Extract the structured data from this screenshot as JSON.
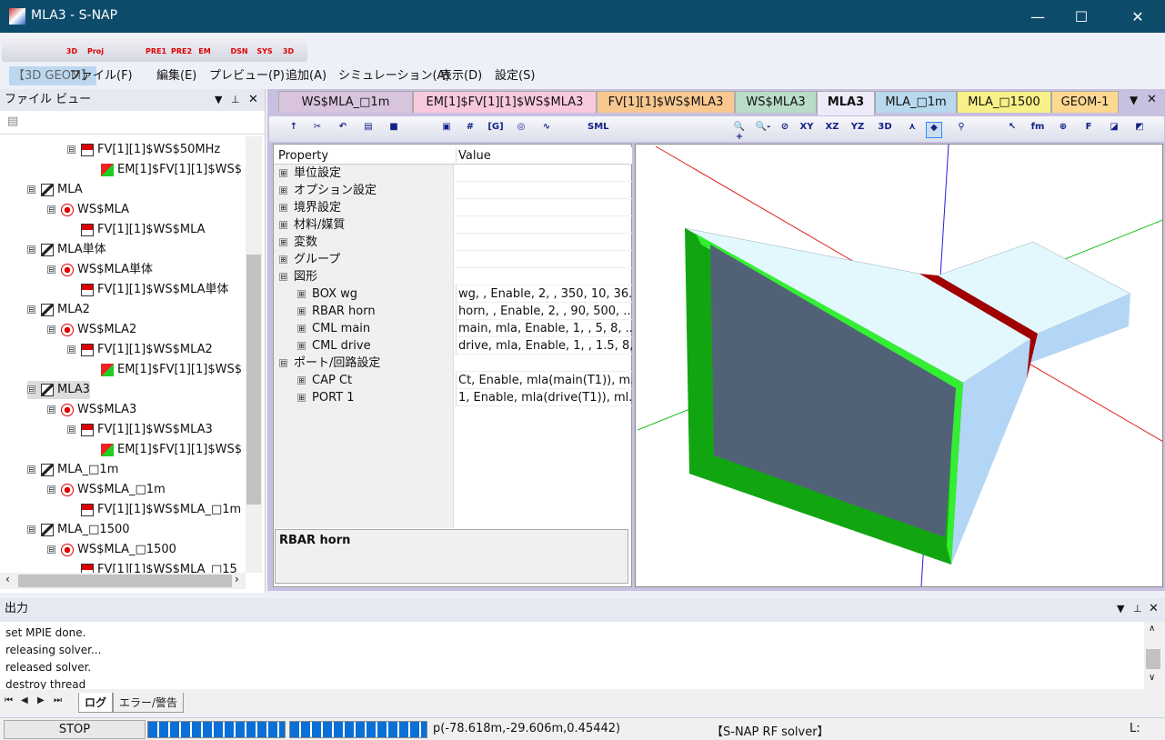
{
  "window": {
    "title": "MLA3 - S-NAP",
    "minimize": "—",
    "maximize": "☐",
    "close": "✕"
  },
  "toolbar": {
    "buttons": [
      {
        "name": "open-icon",
        "label": ""
      },
      {
        "name": "layout-icon",
        "label": ""
      },
      {
        "name": "3d-icon",
        "label": "3D"
      },
      {
        "name": "proj-icon",
        "label": "Proj"
      },
      {
        "name": "save-icon",
        "label": ""
      },
      {
        "name": "pre1-icon",
        "label": "PRE1"
      },
      {
        "name": "pre2-icon",
        "label": "PRE2"
      },
      {
        "name": "em-icon",
        "label": "EM"
      },
      {
        "name": "dsn-icon",
        "label": "DSN"
      },
      {
        "name": "sys-icon",
        "label": "SYS"
      },
      {
        "name": "3d-help-icon",
        "label": "3D"
      }
    ]
  },
  "menu": {
    "items": [
      "【3D GEOM】",
      "ファイル(F)",
      "編集(E)",
      "プレビュー(P)",
      "追加(A)",
      "シミュレーション(A)",
      "表示(D)",
      "設定(S)"
    ]
  },
  "fileview": {
    "title": "ファイル ビュー",
    "items": [
      {
        "level": 2,
        "icon": "fv",
        "exp": "⊟",
        "text": "FV[1][1]$WS$50MHz"
      },
      {
        "level": 3,
        "icon": "em",
        "exp": "",
        "text": "EM[1]$FV[1][1]$WS$"
      },
      {
        "level": 0,
        "icon": "geom",
        "exp": "⊟",
        "text": "MLA"
      },
      {
        "level": 1,
        "icon": "ws",
        "exp": "⊟",
        "text": "WS$MLA"
      },
      {
        "level": 2,
        "icon": "fv",
        "exp": "",
        "text": "FV[1][1]$WS$MLA"
      },
      {
        "level": 0,
        "icon": "geom",
        "exp": "⊟",
        "text": "MLA単体"
      },
      {
        "level": 1,
        "icon": "ws",
        "exp": "⊟",
        "text": "WS$MLA単体"
      },
      {
        "level": 2,
        "icon": "fv",
        "exp": "",
        "text": "FV[1][1]$WS$MLA単体"
      },
      {
        "level": 0,
        "icon": "geom",
        "exp": "⊟",
        "text": "MLA2"
      },
      {
        "level": 1,
        "icon": "ws",
        "exp": "⊟",
        "text": "WS$MLA2"
      },
      {
        "level": 2,
        "icon": "fv",
        "exp": "⊟",
        "text": "FV[1][1]$WS$MLA2"
      },
      {
        "level": 3,
        "icon": "em",
        "exp": "",
        "text": "EM[1]$FV[1][1]$WS$"
      },
      {
        "level": 0,
        "icon": "geom",
        "exp": "⊟",
        "text": "MLA3",
        "selected": true
      },
      {
        "level": 1,
        "icon": "ws",
        "exp": "⊟",
        "text": "WS$MLA3"
      },
      {
        "level": 2,
        "icon": "fv",
        "exp": "⊟",
        "text": "FV[1][1]$WS$MLA3"
      },
      {
        "level": 3,
        "icon": "em",
        "exp": "",
        "text": "EM[1]$FV[1][1]$WS$"
      },
      {
        "level": 0,
        "icon": "geom",
        "exp": "⊟",
        "text": "MLA_□1m"
      },
      {
        "level": 1,
        "icon": "ws",
        "exp": "⊟",
        "text": "WS$MLA_□1m"
      },
      {
        "level": 2,
        "icon": "fv",
        "exp": "",
        "text": "FV[1][1]$WS$MLA_□1m"
      },
      {
        "level": 0,
        "icon": "geom",
        "exp": "⊟",
        "text": "MLA_□1500"
      },
      {
        "level": 1,
        "icon": "ws",
        "exp": "⊟",
        "text": "WS$MLA_□1500"
      },
      {
        "level": 2,
        "icon": "fv",
        "exp": "",
        "text": "FV[1][1]$WS$MLA_□15"
      }
    ]
  },
  "tabs": [
    {
      "label": "WS$MLA_□1m",
      "color": "#d8c4dc"
    },
    {
      "label": "EM[1]$FV[1][1]$WS$MLA3",
      "color": "#f8c8dc"
    },
    {
      "label": "FV[1][1]$WS$MLA3",
      "color": "#f8c890"
    },
    {
      "label": "WS$MLA3",
      "color": "#b8dcc8"
    },
    {
      "label": "MLA3",
      "color": "#eeeaf8",
      "active": true
    },
    {
      "label": "MLA_□1m",
      "color": "#b8d8ec"
    },
    {
      "label": "MLA_□1500",
      "color": "#f8f088"
    },
    {
      "label": "GEOM-1",
      "color": "#fcd890"
    }
  ],
  "viewtools": [
    "↑",
    "✂",
    "↶",
    "▤",
    "■",
    "▣",
    "#",
    "[G]",
    "◎",
    "∿",
    "SML",
    "🔍+",
    "🔍-",
    "⊘",
    "XY",
    "XZ",
    "YZ",
    "3D",
    "⋏",
    "◆",
    "⚲",
    "↖",
    "fm",
    "⊕",
    "F",
    "◪",
    "◩"
  ],
  "propgrid": {
    "header_property": "Property",
    "header_value": "Value",
    "rows": [
      {
        "type": "cat",
        "exp": "⊞",
        "key": "単位設定",
        "value": ""
      },
      {
        "type": "cat",
        "exp": "⊞",
        "key": "オプション設定",
        "value": ""
      },
      {
        "type": "cat",
        "exp": "⊞",
        "key": "境界設定",
        "value": ""
      },
      {
        "type": "cat",
        "exp": "⊞",
        "key": "材料/媒質",
        "value": ""
      },
      {
        "type": "cat",
        "exp": "⊞",
        "key": "変数",
        "value": ""
      },
      {
        "type": "cat",
        "exp": "⊞",
        "key": "グループ",
        "value": ""
      },
      {
        "type": "cat",
        "exp": "⊟",
        "key": "図形",
        "value": ""
      },
      {
        "type": "sub",
        "exp": "⊞",
        "key": "BOX wg",
        "value": "wg, , Enable, 2, , 350, 10, 36..."
      },
      {
        "type": "sub",
        "exp": "⊞",
        "key": "RBAR horn",
        "value": "horn, , Enable, 2, , 90, 500, ..."
      },
      {
        "type": "sub",
        "exp": "⊞",
        "key": "CML main",
        "value": "main, mla, Enable, 1, , 5, 8, ..."
      },
      {
        "type": "sub",
        "exp": "⊞",
        "key": "CML drive",
        "value": "drive, mla, Enable, 1, , 1.5, 8,..."
      },
      {
        "type": "cat",
        "exp": "⊟",
        "key": "ポート/回路設定",
        "value": ""
      },
      {
        "type": "sub",
        "exp": "⊞",
        "key": "CAP Ct",
        "value": "Ct, Enable, mla(main(T1)), m..."
      },
      {
        "type": "sub",
        "exp": "⊞",
        "key": "PORT 1",
        "value": "1, Enable, mla(drive(T1)), ml..."
      }
    ],
    "description": "RBAR horn"
  },
  "output": {
    "title": "出力",
    "lines": [
      "set MPIE done.",
      "releasing solver...",
      "released solver.",
      "destroy thread"
    ],
    "tabs": [
      "ログ",
      "エラー/警告"
    ],
    "nav": [
      "⏮",
      "◀",
      "▶",
      "⏭"
    ]
  },
  "status": {
    "stop": "STOP",
    "progress1": 1.0,
    "progress2": 1.0,
    "coords": "p(-78.618m,-29.606m,0.45442)",
    "solver": "【S-NAP RF solver】",
    "mode": "L:"
  }
}
